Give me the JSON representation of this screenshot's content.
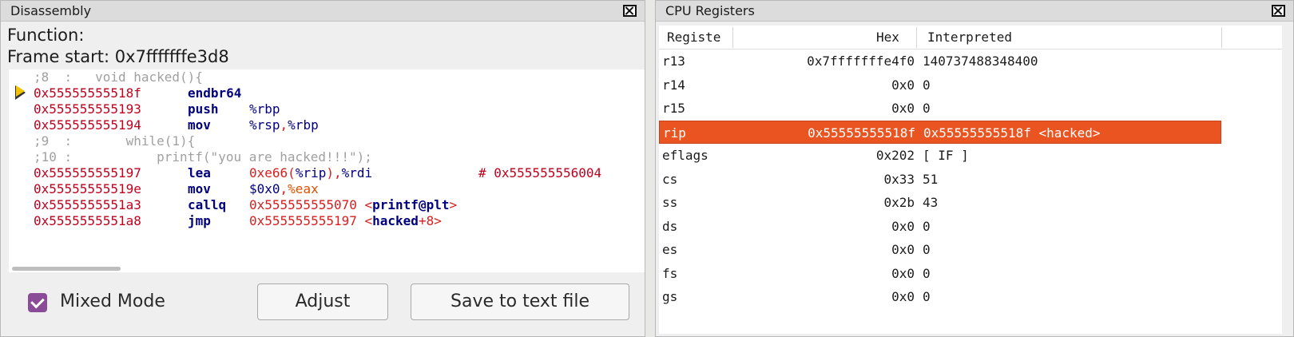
{
  "disassembly": {
    "title": "Disassembly",
    "function_label": "Function:",
    "frame_start_label": "Frame start:",
    "frame_start_value": "0x7fffffffe3d8",
    "lines": [
      {
        "kind": "comment",
        "text": ";8  :   void hacked(){"
      },
      {
        "kind": "asm",
        "current": true,
        "addr": "0x55555555518f",
        "mnem": "endbr64",
        "ops": []
      },
      {
        "kind": "asm",
        "addr": "0x555555555193",
        "mnem": "push",
        "ops": [
          {
            "t": "%rbp",
            "c": "op"
          }
        ]
      },
      {
        "kind": "asm",
        "addr": "0x555555555194",
        "mnem": "mov",
        "ops": [
          {
            "t": "%rsp",
            "c": "op"
          },
          {
            "t": ",",
            "c": "red"
          },
          {
            "t": "%rbp",
            "c": "op"
          }
        ]
      },
      {
        "kind": "comment",
        "text": ";9  :       while(1){"
      },
      {
        "kind": "comment",
        "text": ";10 :           printf(\"you are hacked!!!\");"
      },
      {
        "kind": "asm",
        "addr": "0x555555555197",
        "mnem": "lea",
        "ops": [
          {
            "t": "0xe66",
            "c": "red"
          },
          {
            "t": "(",
            "c": "red"
          },
          {
            "t": "%rip",
            "c": "op"
          },
          {
            "t": "),",
            "c": "red"
          },
          {
            "t": "%rdi",
            "c": "op"
          }
        ],
        "comment": "# 0x555555556004"
      },
      {
        "kind": "asm",
        "addr": "0x55555555519e",
        "mnem": "mov",
        "ops": [
          {
            "t": "$0x0",
            "c": "op"
          },
          {
            "t": ",",
            "c": "red"
          },
          {
            "t": "%eax",
            "c": "orange"
          }
        ]
      },
      {
        "kind": "asm",
        "addr": "0x5555555551a3",
        "mnem": "callq",
        "ops": [
          {
            "t": "0x555555555070 ",
            "c": "red"
          },
          {
            "t": "<",
            "c": "red"
          },
          {
            "t": "printf@plt",
            "c": "sym"
          },
          {
            "t": ">",
            "c": "red"
          }
        ]
      },
      {
        "kind": "asm",
        "addr": "0x5555555551a8",
        "mnem": "jmp",
        "ops": [
          {
            "t": "0x555555555197 ",
            "c": "red"
          },
          {
            "t": "<",
            "c": "red"
          },
          {
            "t": "hacked",
            "c": "sym"
          },
          {
            "t": "+8>",
            "c": "red"
          }
        ]
      }
    ],
    "mixed_mode_label": "Mixed Mode",
    "mixed_mode_checked": true,
    "adjust_label": "Adjust",
    "save_label": "Save to text file"
  },
  "registers": {
    "title": "CPU Registers",
    "headers": {
      "register": "Registe",
      "hex": "Hex",
      "interpreted": "Interpreted"
    },
    "rows": [
      {
        "name": "r13",
        "hex": "0x7fffffffe4f0",
        "interpreted": "140737488348400"
      },
      {
        "name": "r14",
        "hex": "0x0",
        "interpreted": "0"
      },
      {
        "name": "r15",
        "hex": "0x0",
        "interpreted": "0"
      },
      {
        "name": "rip",
        "hex": "0x55555555518f",
        "interpreted": "0x55555555518f <hacked>",
        "selected": true
      },
      {
        "name": "eflags",
        "hex": "0x202",
        "interpreted": "[ IF ]"
      },
      {
        "name": "cs",
        "hex": "0x33",
        "interpreted": "51"
      },
      {
        "name": "ss",
        "hex": "0x2b",
        "interpreted": "43"
      },
      {
        "name": "ds",
        "hex": "0x0",
        "interpreted": "0"
      },
      {
        "name": "es",
        "hex": "0x0",
        "interpreted": "0"
      },
      {
        "name": "fs",
        "hex": "0x0",
        "interpreted": "0"
      },
      {
        "name": "gs",
        "hex": "0x0",
        "interpreted": "0"
      }
    ]
  },
  "colors": {
    "accent": "#e95420",
    "checkbox": "#8a4b97",
    "address": "#c1001d",
    "mnemonic": "#00007f"
  },
  "icons": {
    "close": "close-icon",
    "current_line": "current-instruction-arrow-icon"
  }
}
